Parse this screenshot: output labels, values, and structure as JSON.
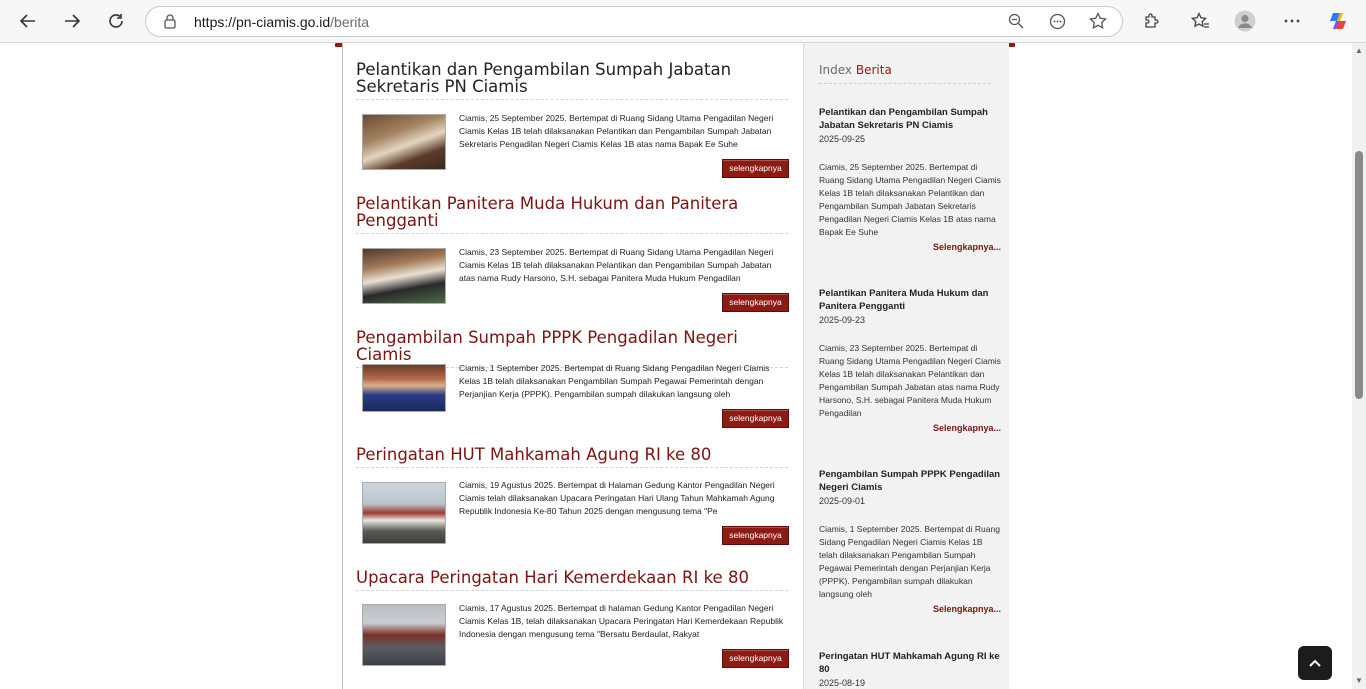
{
  "browser": {
    "url_host": "https://pn-ciamis.go.id",
    "url_path": "/berita"
  },
  "main": {
    "articles": [
      {
        "title": "Pelantikan dan Pengambilan Sumpah Jabatan Sekretaris PN Ciamis",
        "excerpt": "Ciamis, 25 September 2025. Bertempat di Ruang Sidang Utama Pengadilan Negeri Ciamis Kelas 1B telah dilaksanakan Pelantikan dan Pengambilan Sumpah Jabatan Sekretaris Pengadilan Negeri Ciamis Kelas 1B atas nama Bapak Ee Suhe",
        "button": "selengkapnya"
      },
      {
        "title": "Pelantikan Panitera Muda Hukum dan Panitera Pengganti",
        "excerpt": "Ciamis, 23 September 2025. Bertempat di Ruang Sidang Utama Pengadilan Negeri Ciamis Kelas 1B telah dilaksanakan Pelantikan dan Pengambilan Sumpah Jabatan atas nama Rudy Harsono, S.H. sebagai Panitera Muda Hukum Pengadilan",
        "button": "selengkapnya"
      },
      {
        "title": "Pengambilan Sumpah PPPK Pengadilan Negeri Ciamis",
        "excerpt": "Ciamis, 1 September 2025. Bertempat di Ruang Sidang Pengadilan Negeri Ciamis Kelas 1B telah dilaksanakan Pengambilan Sumpah Pegawai Pemerintah dengan Perjanjian Kerja (PPPK). Pengambilan sumpah dilakukan langsung oleh",
        "button": "selengkapnya"
      },
      {
        "title": "Peringatan HUT Mahkamah Agung RI ke 80",
        "excerpt": "Ciamis, 19 Agustus 2025. Bertempat di Halaman Gedung Kantor Pengadilan Negeri Ciamis telah dilaksanakan Upacara Peringatan Hari Ulang Tahun Mahkamah Agung Republik Indonesia Ke-80 Tahun 2025 dengan mengusung tema \"Pe",
        "button": "selengkapnya"
      },
      {
        "title": "Upacara Peringatan Hari Kemerdekaan RI ke 80",
        "excerpt": "Ciamis, 17 Agustus 2025. Bertempat di halaman Gedung Kantor Pengadilan Negeri Ciamis Kelas 1B, telah dilaksanakan Upacara Peringatan Hari Kemerdekaan Republik Indonesia dengan mengusung tema \"Bersatu Berdaulat, Rakyat",
        "button": "selengkapnya"
      }
    ]
  },
  "sidebar": {
    "heading_prefix": "Index",
    "heading_accent": "Berita",
    "items": [
      {
        "title": "Pelantikan dan Pengambilan Sumpah Jabatan Sekretaris PN Ciamis",
        "date": "2025-09-25",
        "excerpt": "Ciamis, 25 September 2025. Bertempat di Ruang Sidang Utama Pengadilan Negeri Ciamis Kelas 1B telah dilaksanakan Pelantikan dan Pengambilan Sumpah Jabatan Sekretaris Pengadilan Negeri Ciamis Kelas 1B atas nama Bapak Ee Suhe",
        "more": "Selengkapnya..."
      },
      {
        "title": "Pelantikan Panitera Muda Hukum dan Panitera Pengganti",
        "date": "2025-09-23",
        "excerpt": "Ciamis, 23 September 2025. Bertempat di Ruang Sidang Utama Pengadilan Negeri Ciamis Kelas 1B telah dilaksanakan Pelantikan dan Pengambilan Sumpah Jabatan atas nama Rudy Harsono, S.H. sebagai Panitera Muda Hukum Pengadilan",
        "more": "Selengkapnya..."
      },
      {
        "title": "Pengambilan Sumpah PPPK Pengadilan Negeri Ciamis",
        "date": "2025-09-01",
        "excerpt": "Ciamis, 1 September 2025. Bertempat di Ruang Sidang Pengadilan Negeri Ciamis Kelas 1B telah dilaksanakan Pengambilan Sumpah Pegawai Pemerintah dengan Perjanjian Kerja (PPPK). Pengambilan sumpah dilakukan langsung oleh",
        "more": "Selengkapnya..."
      },
      {
        "title": "Peringatan HUT Mahkamah Agung RI ke 80",
        "date": "2025-08-19"
      }
    ]
  }
}
